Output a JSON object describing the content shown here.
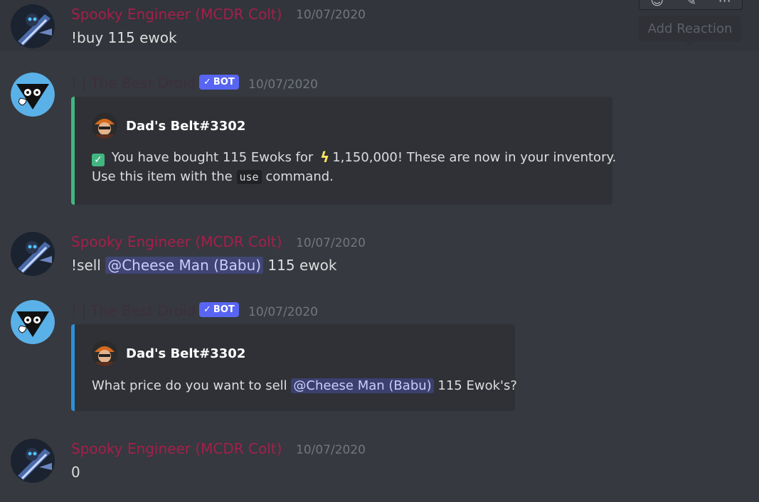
{
  "messages": [
    {
      "author": "Spooky Engineer (MCDR Colt)",
      "timestamp": "10/07/2020",
      "content": "!buy 115 ewok"
    },
    {
      "author": "! | The Best Droid",
      "bot_tag": "BOT",
      "timestamp": "10/07/2020",
      "embed": {
        "author": "Dad's Belt#3302",
        "accent_color": "#43b581",
        "line1_pre": "You have bought 115 Ewoks for",
        "line1_amount": "1,150,000! These are now in your inventory.",
        "line2_pre": "Use this item with the",
        "line2_code": "use",
        "line2_post": "command."
      }
    },
    {
      "author": "Spooky Engineer (MCDR Colt)",
      "timestamp": "10/07/2020",
      "content_pre": "!sell",
      "mention": "@Cheese Man (Babu)",
      "content_post": "115 ewok"
    },
    {
      "author": "! | The Best Droid",
      "bot_tag": "BOT",
      "timestamp": "10/07/2020",
      "embed": {
        "author": "Dad's Belt#3302",
        "accent_color": "#2f8fd8",
        "desc_pre": "What price do you want to sell",
        "mention": "@Cheese Man (Babu)",
        "desc_post": "115 Ewok's?"
      }
    },
    {
      "author": "Spooky Engineer (MCDR Colt)",
      "timestamp": "10/07/2020",
      "content": "0"
    }
  ],
  "tooltip": "Add Reaction",
  "toolbar_icons": [
    "add-reaction-icon",
    "edit-icon",
    "more-icon"
  ],
  "colors": {
    "background": "#36393f",
    "spooky_name": "#a3204b",
    "bot_tag": "#5865f2",
    "embed_bg": "#2f3136"
  }
}
